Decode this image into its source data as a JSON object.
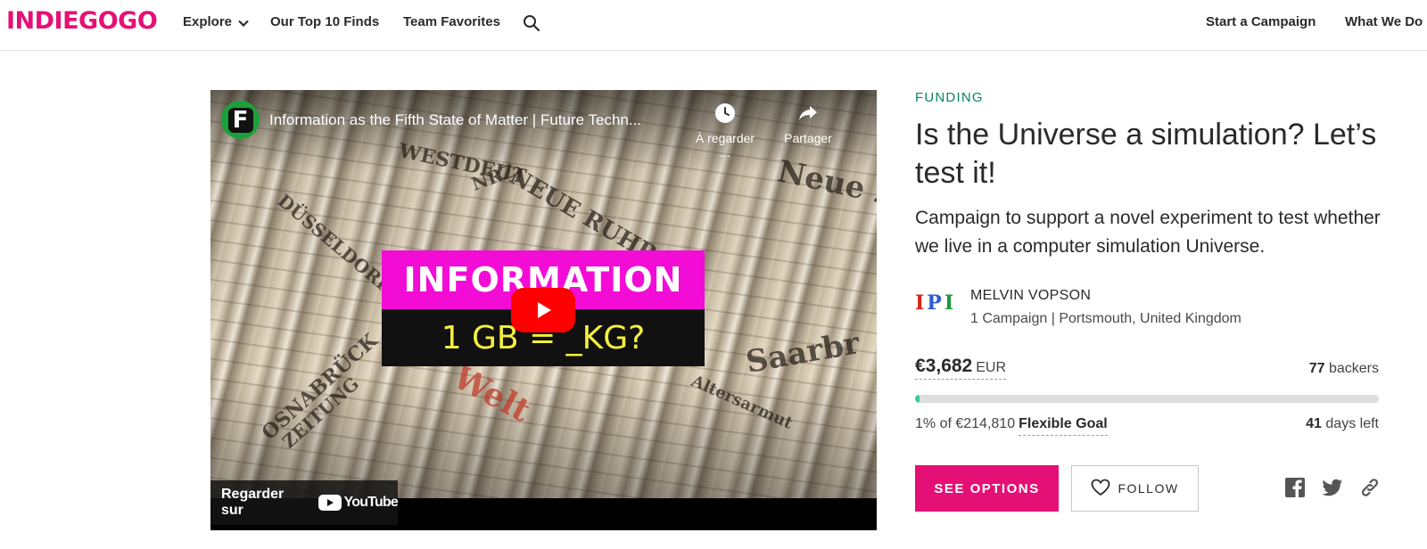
{
  "header": {
    "logo": "INDIEGOGO",
    "nav": {
      "explore": "Explore",
      "top10": "Our Top 10 Finds",
      "team_favorites": "Team Favorites",
      "start_campaign": "Start a Campaign",
      "what_we_do": "What We Do"
    },
    "icons": {
      "explore_chevron": "chevron-down-icon",
      "search": "search-icon"
    }
  },
  "video": {
    "channel_badge": "F",
    "title": "Information as the Fifth State of Matter | Future Techn...",
    "watch_later_label": "À regarder ...",
    "share_label": "Partager",
    "thumbnail": {
      "top_text": "INFORMATION",
      "bottom_text": "1 GB = _KG?",
      "newspaper_headlines": [
        "WESTDEUT",
        "NRZ",
        "NEUE RUHR",
        "DÜSSELDORF",
        "OSNABRÜCK",
        "ZEITUNG",
        "Saarbr",
        "Neue Z",
        "Welt",
        "Altersarmut"
      ]
    },
    "watch_on_label": "Regarder sur",
    "youtube_label": "YouTube",
    "icons": {
      "play": "play-icon",
      "watch_later": "clock-icon",
      "share": "share-icon",
      "youtube": "youtube-icon"
    }
  },
  "campaign": {
    "category": "FUNDING",
    "title": "Is the Universe a simulation? Let’s test it!",
    "tagline": "Campaign to support a novel experiment to test whether we live in a computer simulation Universe.",
    "owner": {
      "avatar_text": [
        "I",
        "P",
        "I"
      ],
      "name": "MELVIN VOPSON",
      "meta": "1 Campaign | Portsmouth, United Kingdom"
    },
    "raised_amount": "€3,682",
    "currency": "EUR",
    "backers_count": "77",
    "backers_label": "backers",
    "progress_percent": 1,
    "goal_text": "1% of €214,810",
    "goal_type": "Flexible Goal",
    "days_count": "41",
    "days_label": "days left",
    "see_options_label": "SEE OPTIONS",
    "follow_label": "FOLLOW",
    "social_icons": [
      "facebook-icon",
      "twitter-icon",
      "link-icon"
    ]
  },
  "colors": {
    "brand": "#e51075",
    "category": "#088366",
    "progress": "#2ecf9a",
    "text": "#2a2a2a",
    "thumb_magenta": "#f20cd6",
    "thumb_yellow": "#f5f03d",
    "youtube_red": "#ff0000"
  }
}
